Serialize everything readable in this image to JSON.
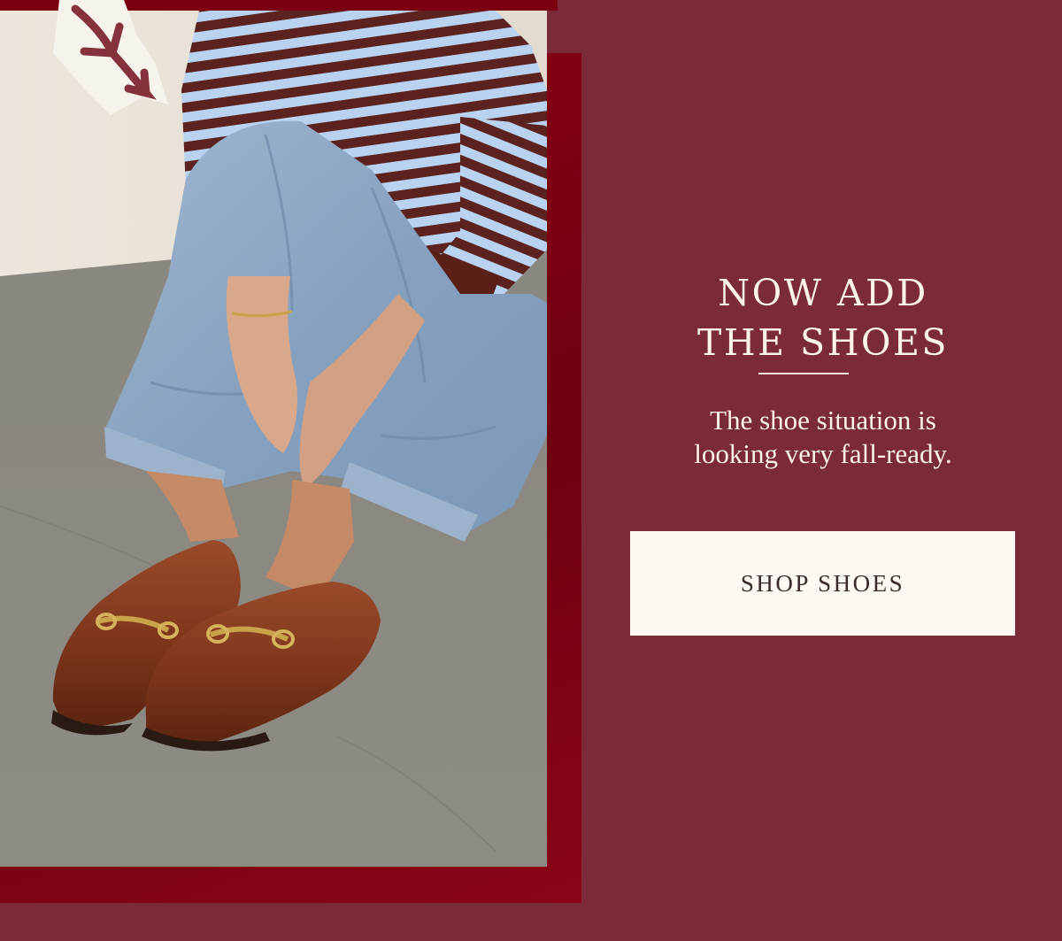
{
  "hero": {
    "headline_line1": "NOW ADD",
    "headline_line2": "THE SHOES",
    "subcopy_line1": "The shoe situation is",
    "subcopy_line2": "looking very fall-ready.",
    "cta_label": "SHOP SHOES"
  },
  "photo": {
    "description_icon": "model-wearing-loafers-photo"
  },
  "sticker": {
    "icon": "arrow-down-icon"
  },
  "colors": {
    "background": "#7b2b37",
    "backing_panel": "#7d0012",
    "text": "#fbf3ea",
    "button_bg": "#fdf8f2",
    "button_text": "#3a2a2c"
  }
}
